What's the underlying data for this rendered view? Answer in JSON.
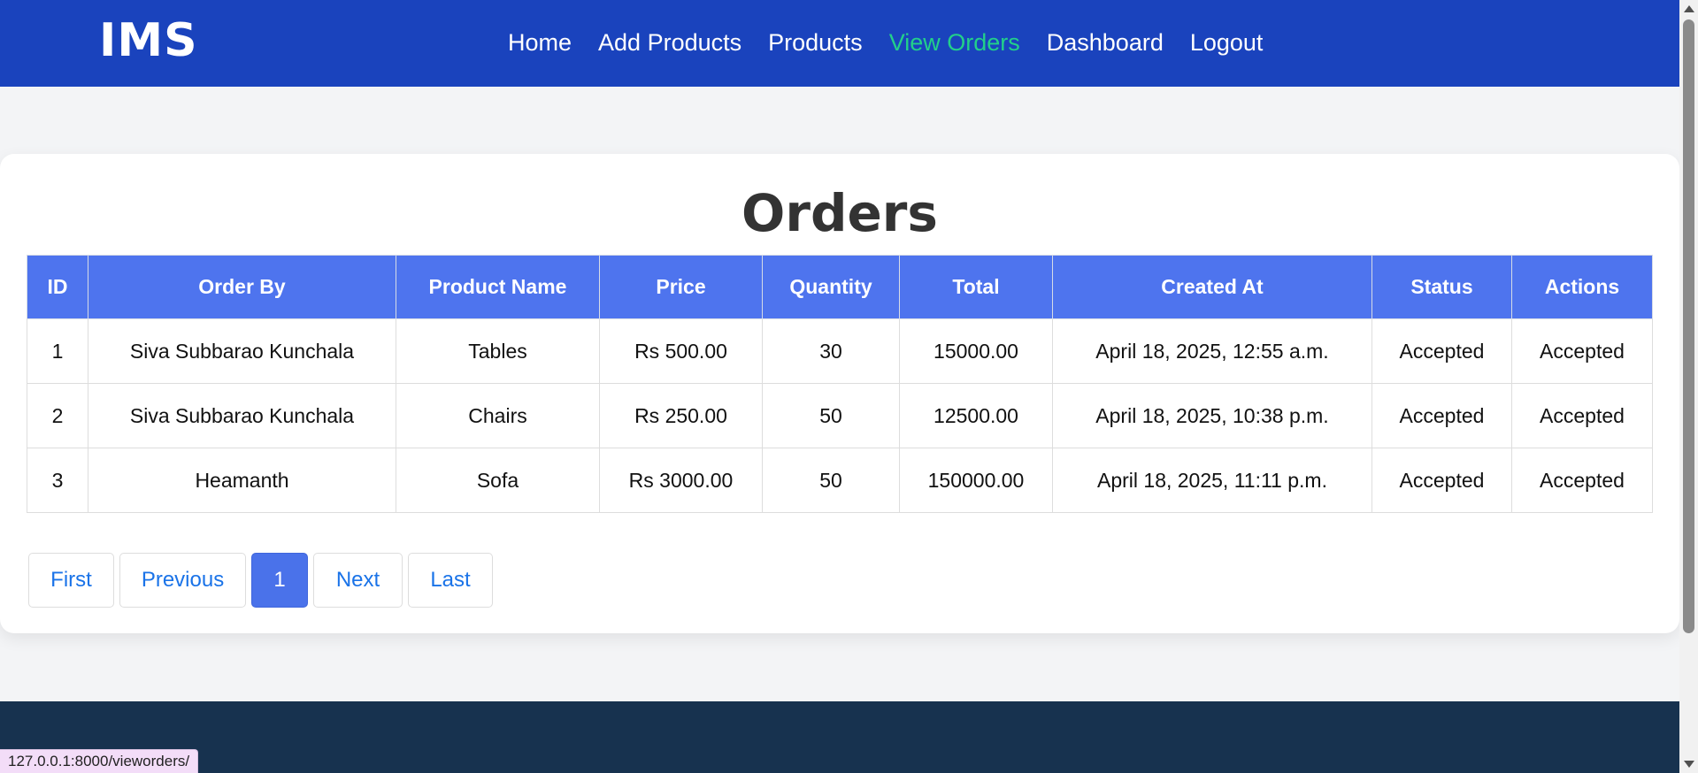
{
  "navbar": {
    "logo": "IMS",
    "links": [
      "Home",
      "Add Products",
      "Products",
      "View Orders",
      "Dashboard",
      "Logout"
    ],
    "active_link": "View Orders",
    "background_color": "#1a43bd",
    "active_color": "#22d08a"
  },
  "main": {
    "title": "Orders",
    "table": {
      "headers": [
        "ID",
        "Order By",
        "Product Name",
        "Price",
        "Quantity",
        "Total",
        "Created At",
        "Status",
        "Actions"
      ],
      "rows": [
        [
          "1",
          "Siva Subbarao Kunchala",
          "Tables",
          "Rs 500.00",
          "30",
          "15000.00",
          "April 18, 2025, 12:55 a.m.",
          "Accepted",
          "Accepted"
        ],
        [
          "2",
          "Siva Subbarao Kunchala",
          "Chairs",
          "Rs 250.00",
          "50",
          "12500.00",
          "April 18, 2025, 10:38 p.m.",
          "Accepted",
          "Accepted"
        ],
        [
          "3",
          "Heamanth",
          "Sofa",
          "Rs 3000.00",
          "50",
          "150000.00",
          "April 18, 2025, 11:11 p.m.",
          "Accepted",
          "Accepted"
        ]
      ],
      "header_color": "#4e74ee"
    },
    "pagination": {
      "first": "First",
      "previous": "Previous",
      "current_page": "1",
      "next": "Next",
      "last": "Last"
    }
  },
  "footer": {
    "background_color": "#17324f"
  },
  "status_bar": {
    "url": "127.0.0.1:8000/vieworders/"
  }
}
